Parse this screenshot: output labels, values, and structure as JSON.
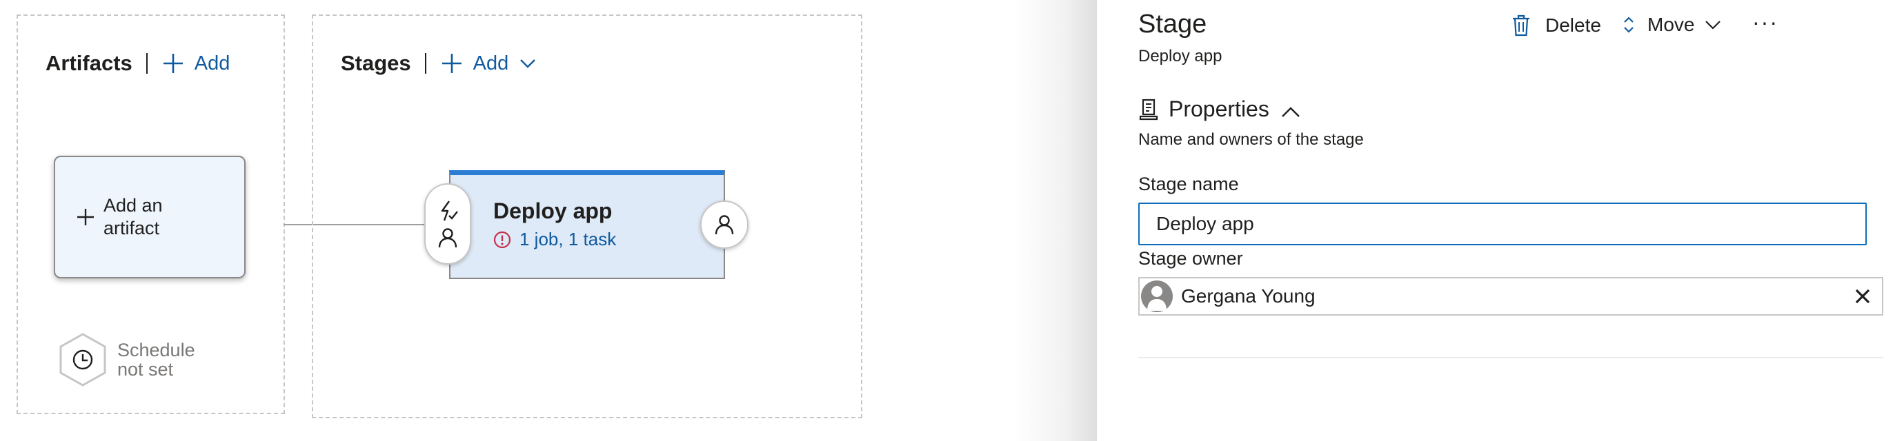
{
  "pipeline": {
    "artifacts": {
      "title": "Artifacts",
      "add_label": "Add",
      "add_artifact_label": "Add an artifact",
      "schedule_label": "Schedule not set"
    },
    "stages": {
      "title": "Stages",
      "add_label": "Add",
      "stage_card": {
        "name": "Deploy app",
        "status_text": "1 job, 1 task",
        "status_icon": "warning-circle-icon"
      }
    }
  },
  "panel": {
    "title": "Stage",
    "subtitle": "Deploy app",
    "commands": {
      "delete_label": "Delete",
      "move_label": "Move",
      "more_label": "···"
    },
    "properties": {
      "header": "Properties",
      "description": "Name and owners of the stage",
      "stage_name_label": "Stage name",
      "stage_name_value": "Deploy app",
      "stage_owner_label": "Stage owner",
      "stage_owner_name": "Gergana Young"
    }
  },
  "colors": {
    "accent": "#0f5a9e",
    "stage_top_bar": "#2b7cd3",
    "stage_bg": "#deeaf7",
    "artifact_bg": "#eff5fc",
    "warning": "#c4314b"
  }
}
